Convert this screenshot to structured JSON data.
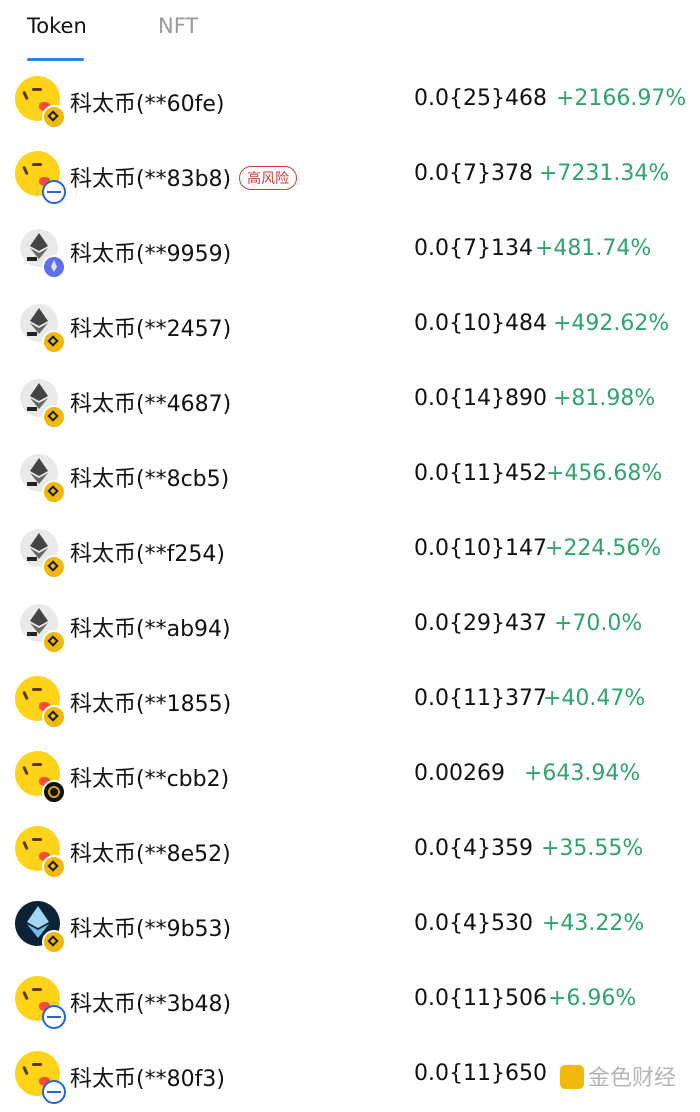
{
  "tabs": [
    {
      "label": "Token",
      "active": true
    },
    {
      "label": "NFT",
      "active": false
    }
  ],
  "tokens": [
    {
      "name": "科太币(**60fe)",
      "price": "0.0{25}468",
      "change": "+2166.97%",
      "icon": "emoji-face-icon",
      "chain": "bnb-chain-icon"
    },
    {
      "name": "科太币(**83b8)",
      "price": "0.0{7}378",
      "change": "+7231.34%",
      "icon": "emoji-face-icon",
      "chain": "base-chain-icon",
      "risk": "高风险"
    },
    {
      "name": "科太币(**9959)",
      "price": "0.0{7}134",
      "change": "+481.74%",
      "icon": "eth-coin-icon",
      "chain": "ethereum-chain-icon"
    },
    {
      "name": "科太币(**2457)",
      "price": "0.0{10}484",
      "change": "+492.62%",
      "icon": "eth-coin-icon",
      "chain": "bnb-chain-icon"
    },
    {
      "name": "科太币(**4687)",
      "price": "0.0{14}890",
      "change": "+81.98%",
      "icon": "eth-coin-icon",
      "chain": "bnb-chain-icon"
    },
    {
      "name": "科太币(**8cb5)",
      "price": "0.0{11}452",
      "change": "+456.68%",
      "icon": "eth-coin-icon",
      "chain": "bnb-chain-icon"
    },
    {
      "name": "科太币(**f254)",
      "price": "0.0{10}147",
      "change": "+224.56%",
      "icon": "eth-coin-icon",
      "chain": "bnb-chain-icon"
    },
    {
      "name": "科太币(**ab94)",
      "price": "0.0{29}437",
      "change": "+70.0%",
      "icon": "eth-coin-icon",
      "chain": "bnb-chain-icon"
    },
    {
      "name": "科太币(**1855)",
      "price": "0.0{11}377",
      "change": "+40.47%",
      "icon": "emoji-face-icon",
      "chain": "bnb-chain-icon"
    },
    {
      "name": "科太币(**cbb2)",
      "price": "0.00269",
      "change": "+643.94%",
      "icon": "emoji-face-icon",
      "chain": "black-chain-icon"
    },
    {
      "name": "科太币(**8e52)",
      "price": "0.0{4}359",
      "change": "+35.55%",
      "icon": "emoji-face-icon",
      "chain": "bnb-chain-icon"
    },
    {
      "name": "科太币(**9b53)",
      "price": "0.0{4}530",
      "change": "+43.22%",
      "icon": "eth-dark-coin-icon",
      "chain": "bnb-chain-icon"
    },
    {
      "name": "科太币(**3b48)",
      "price": "0.0{11}506",
      "change": "+6.96%",
      "icon": "emoji-face-icon",
      "chain": "base-chain-icon"
    },
    {
      "name": "科太币(**80f3)",
      "price": "0.0{11}650",
      "change": "",
      "icon": "emoji-face-icon",
      "chain": "base-chain-icon"
    }
  ],
  "watermark": {
    "text": "金色财经"
  },
  "colors": {
    "positive": "#2fa46d",
    "risk": "#d23b3b",
    "tab_underline": "#2f7fe0"
  }
}
